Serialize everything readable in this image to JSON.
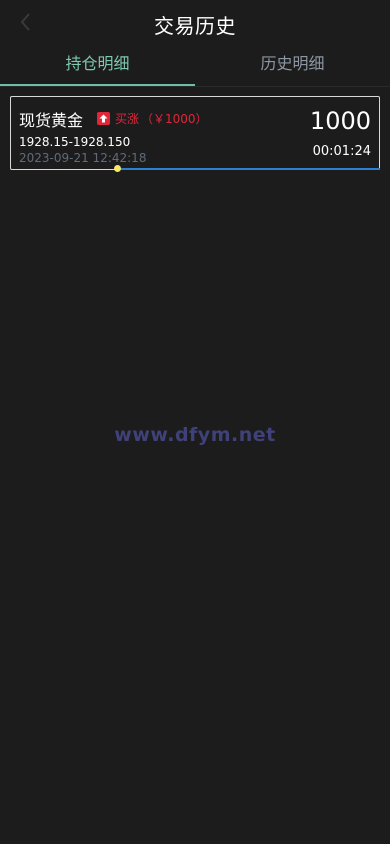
{
  "header": {
    "title": "交易历史",
    "back_icon": "chevron-left-icon"
  },
  "tabs": [
    {
      "label": "持仓明细",
      "active": true
    },
    {
      "label": "历史明细",
      "active": false
    }
  ],
  "position": {
    "product": "现货黄金",
    "direction_icon": "arrow-up-icon",
    "direction_label": "买涨",
    "amount_paren": "（￥1000）",
    "amount": "1000",
    "price_range": "1928.15-1928.150",
    "time": "2023-09-21 12:42:18",
    "countdown": "00:01:24",
    "progress": 0.29
  },
  "watermark": "www.dfym.net",
  "colors": {
    "background": "#1c1c1c",
    "active_tab": "#7dc8ae",
    "inactive_tab": "#8e96a3",
    "rise": "#e0263a",
    "progress": "#2f7fd1",
    "knob": "#f5e96a",
    "watermark": "#3f4178"
  }
}
